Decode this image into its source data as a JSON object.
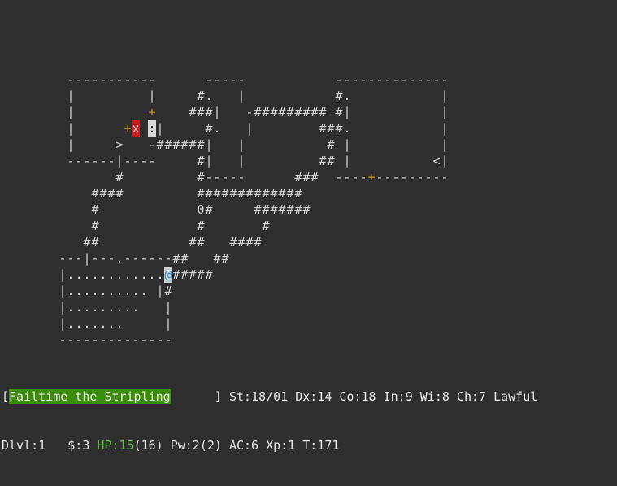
{
  "map": {
    "rows": [
      "",
      "",
      "",
      "",
      "        -----------      -----           --------------",
      "        |         |     #.   |           #.           |",
      "        |         +    ###|   -######### #|           |",
      "        |      +x :|     #.   |        ###.           |",
      "        |     >   -######|   |          # |           |",
      "        ------|----     #|   |         ## |          <|",
      "              #         #-----      ###  ----+---------",
      "           ####         #############",
      "           #            0#     #######",
      "           #            #       #",
      "          ##           ##   ####",
      "       ---|---.------##   ##",
      "       |............@#####",
      "       |.......... |#",
      "       |.........   |",
      "       |.......     |",
      "       --------------"
    ],
    "special_glyphs": {
      "monster_red": "x",
      "monster_gray": ":",
      "player": "@",
      "door_glyph": "+"
    }
  },
  "status": {
    "name_field": "Failtime the Stripling",
    "stats": "St:18/01 Dx:14 Co:18 In:9 Wi:8 Ch:7 Lawful",
    "dlvl": "Dlvl:1",
    "gold": "$:3",
    "hp_label": "HP:15",
    "hp_max": "(16)",
    "power": "Pw:2(2)",
    "ac": "AC:6",
    "xp": "Xp:1",
    "turn": "T:171"
  },
  "colors": {
    "background": "#2f2f2f",
    "text": "#d2d2d2",
    "door": "#c8961e",
    "hp_bar": "#3c8c0c",
    "player": "#2a8fbf"
  }
}
